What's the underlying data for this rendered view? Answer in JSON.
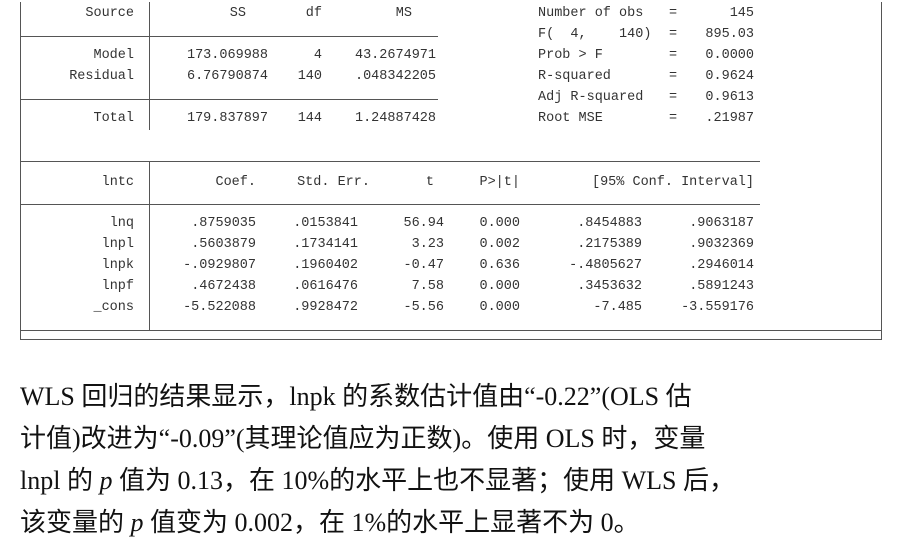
{
  "anova": {
    "headers": [
      "Source",
      "SS",
      "df",
      "MS"
    ],
    "rows": [
      {
        "source": "Model",
        "ss": "173.069988",
        "df": "4",
        "ms": "43.2674971"
      },
      {
        "source": "Residual",
        "ss": "6.76790874",
        "df": "140",
        "ms": ".048342205"
      },
      {
        "source": "Total",
        "ss": "179.837897",
        "df": "144",
        "ms": "1.24887428"
      }
    ]
  },
  "stats": [
    {
      "label": "Number of obs",
      "eq": "=",
      "value": "145"
    },
    {
      "label": "F(  4,    140)",
      "eq": "=",
      "value": "895.03"
    },
    {
      "label": "Prob > F",
      "eq": "=",
      "value": "0.0000"
    },
    {
      "label": "R-squared",
      "eq": "=",
      "value": "0.9624"
    },
    {
      "label": "Adj R-squared",
      "eq": "=",
      "value": "0.9613"
    },
    {
      "label": "Root MSE",
      "eq": "=",
      "value": ".21987"
    }
  ],
  "coef": {
    "headers": {
      "var": "lntc",
      "coef": "Coef.",
      "se": "Std. Err.",
      "t": "t",
      "p": "P>|t|",
      "ci": "[95% Conf. Interval]"
    },
    "rows": [
      {
        "var": "lnq",
        "coef": ".8759035",
        "se": ".0153841",
        "t": "56.94",
        "p": "0.000",
        "lo": ".8454883",
        "hi": ".9063187"
      },
      {
        "var": "lnpl",
        "coef": ".5603879",
        "se": ".1734141",
        "t": "3.23",
        "p": "0.002",
        "lo": ".2175389",
        "hi": ".9032369"
      },
      {
        "var": "lnpk",
        "coef": "-.0929807",
        "se": ".1960402",
        "t": "-0.47",
        "p": "0.636",
        "lo": "-.4805627",
        "hi": ".2946014"
      },
      {
        "var": "lnpf",
        "coef": ".4672438",
        "se": ".0616476",
        "t": "7.58",
        "p": "0.000",
        "lo": ".3453632",
        "hi": ".5891243"
      },
      {
        "var": "_cons",
        "coef": "-5.522088",
        "se": ".9928472",
        "t": "-5.56",
        "p": "0.000",
        "lo": "-7.485",
        "hi": "-3.559176"
      }
    ]
  },
  "paragraph": {
    "line1": "WLS 回归的结果显示，lnpk 的系数估计值由“-0.22”(OLS 估",
    "line2": "计值)改进为“-0.09”(其理论值应为正数)。使用 OLS 时，变量",
    "line3a": "lnpl 的 ",
    "line3p": "p",
    "line3b": " 值为 0.13，在 10%的水平上也不显著；使用 WLS 后，",
    "line4a": "该变量的 ",
    "line4p": "p",
    "line4b": " 值变为 0.002，在 1%的水平上显著不为 0。"
  }
}
